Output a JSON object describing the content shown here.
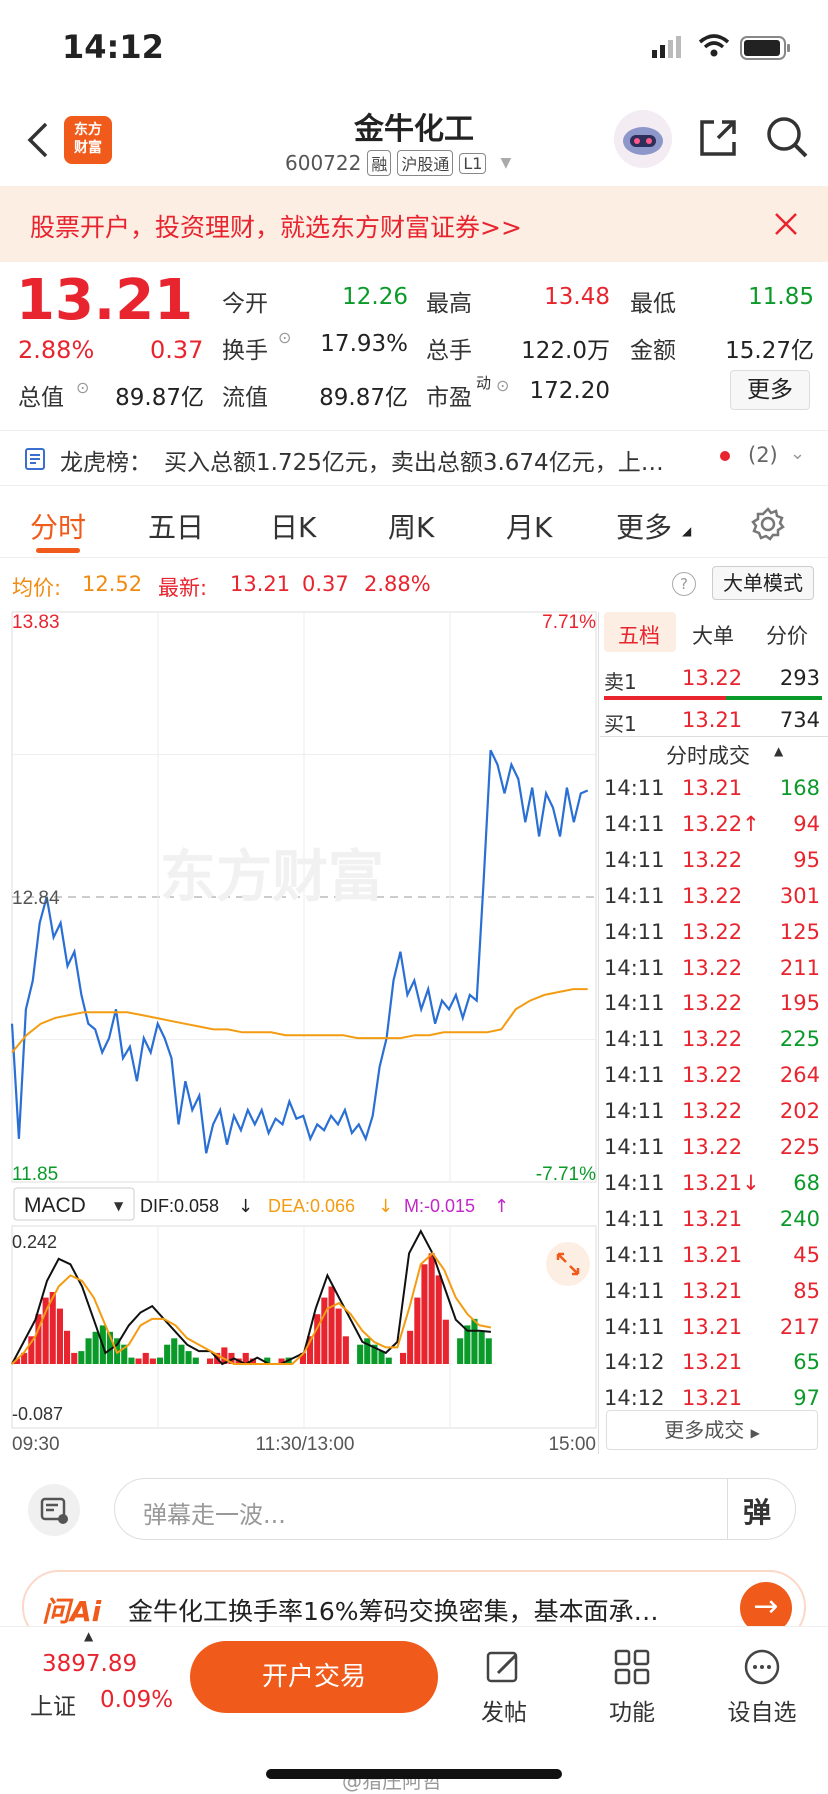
{
  "status_bar": {
    "time": "14:12"
  },
  "header": {
    "stock_name": "金牛化工",
    "stock_code": "600722",
    "tags": [
      "融",
      "沪股通",
      "L1"
    ],
    "logo_text": "东方财富"
  },
  "banner": {
    "text": "股票开户，投资理财，就选东方财富证券>>"
  },
  "quote": {
    "price": "13.21",
    "change_pct": "2.88%",
    "change": "0.37",
    "labels": {
      "open": "今开",
      "high": "最高",
      "low": "最低",
      "turnover": "换手",
      "volume": "总手",
      "amount": "金额",
      "market_cap": "总值",
      "float_cap": "流值",
      "pe": "市盈",
      "pe_sup": "动"
    },
    "values": {
      "open": "12.26",
      "high": "13.48",
      "low": "11.85",
      "turnover": "17.93%",
      "volume": "122.0万",
      "amount": "15.27亿",
      "market_cap": "89.87亿",
      "float_cap": "89.87亿",
      "pe": "172.20"
    },
    "more_button": "更多"
  },
  "dragon": {
    "label": "龙虎榜：",
    "text": "买入总额1.725亿元，卖出总额3.674亿元，上…",
    "count": "(2)"
  },
  "tabs": [
    "分时",
    "五日",
    "日K",
    "周K",
    "月K",
    "更多"
  ],
  "info_line": {
    "avg_label": "均价:",
    "avg_value": "12.52",
    "latest_label": "最新:",
    "latest_value": "13.21",
    "latest_change": "0.37",
    "latest_pct": "2.88%",
    "big_order_mode": "大单模式"
  },
  "chart_data": {
    "type": "line",
    "title": "",
    "x_labels": [
      "09:30",
      "11:30/13:00",
      "15:00"
    ],
    "ylim": [
      11.85,
      13.83
    ],
    "y_top_label": "13.83",
    "y_mid_label": "12.84",
    "y_bottom_label": "11.85",
    "pct_top_label": "7.71%",
    "pct_bottom_label": "-7.71%",
    "watermark": "东方财富",
    "series": [
      {
        "name": "price",
        "color": "#2a6fd4",
        "values": [
          12.4,
          12.0,
          12.45,
          12.55,
          12.75,
          12.84,
          12.7,
          12.75,
          12.6,
          12.65,
          12.5,
          12.4,
          12.38,
          12.3,
          12.35,
          12.45,
          12.28,
          12.32,
          12.2,
          12.35,
          12.3,
          12.4,
          12.35,
          12.28,
          12.05,
          12.2,
          12.1,
          12.15,
          11.95,
          12.05,
          12.1,
          11.98,
          12.08,
          12.03,
          12.1,
          12.05,
          12.1,
          12.02,
          12.07,
          12.05,
          12.13,
          12.07,
          12.08,
          12.0,
          12.05,
          12.03,
          12.08,
          12.05,
          12.1,
          12.02,
          12.05,
          12.0,
          12.08,
          12.25,
          12.35,
          12.55,
          12.65,
          12.5,
          12.55,
          12.45,
          12.52,
          12.4,
          12.48,
          12.45,
          12.5,
          12.42,
          12.5,
          12.48,
          12.9,
          13.35,
          13.3,
          13.2,
          13.3,
          13.25,
          13.1,
          13.22,
          13.05,
          13.2,
          13.15,
          13.05,
          13.22,
          13.1,
          13.2,
          13.21
        ]
      },
      {
        "name": "avg",
        "color": "#f39c12",
        "values": [
          12.3,
          12.36,
          12.4,
          12.42,
          12.43,
          12.44,
          12.44,
          12.44,
          12.44,
          12.43,
          12.42,
          12.41,
          12.4,
          12.39,
          12.38,
          12.38,
          12.37,
          12.37,
          12.37,
          12.36,
          12.36,
          12.36,
          12.36,
          12.36,
          12.35,
          12.35,
          12.35,
          12.35,
          12.36,
          12.36,
          12.37,
          12.37,
          12.37,
          12.37,
          12.38,
          12.45,
          12.48,
          12.5,
          12.51,
          12.52,
          12.52
        ]
      }
    ]
  },
  "macd": {
    "label": "MACD",
    "dif": "DIF:0.058",
    "dea": "DEA:0.066",
    "m": "M:-0.015",
    "y_top": "0.242",
    "y_bottom": "-0.087",
    "hist": [
      0.01,
      0.02,
      0.05,
      0.09,
      0.12,
      0.13,
      0.1,
      0.06,
      0.02,
      -0.02,
      -0.04,
      -0.05,
      -0.06,
      -0.05,
      -0.04,
      -0.03,
      -0.01,
      0.01,
      0.02,
      0.01,
      -0.01,
      -0.03,
      -0.04,
      -0.03,
      -0.02,
      -0.01,
      0.0,
      0.01,
      0.02,
      0.03,
      0.02,
      0.01,
      0.02,
      0.01,
      0.0,
      -0.01,
      0.0,
      0.01,
      -0.01,
      0.0,
      0.02,
      0.05,
      0.09,
      0.12,
      0.14,
      0.1,
      0.05,
      0.0,
      -0.03,
      -0.04,
      -0.03,
      -0.02,
      -0.01,
      0.0,
      0.02,
      0.06,
      0.12,
      0.18,
      0.2,
      0.16,
      0.08,
      0.0,
      -0.04,
      -0.06,
      -0.07,
      -0.05,
      -0.04
    ],
    "dif_line": [
      0.0,
      0.04,
      0.08,
      0.15,
      0.19,
      0.18,
      0.14,
      0.08,
      0.02,
      -0.03,
      -0.06,
      -0.08,
      -0.09,
      -0.07,
      -0.05,
      -0.03,
      -0.02,
      -0.02,
      0.0,
      0.01,
      0.0,
      -0.01,
      0.0,
      0.0,
      0.01,
      0.02,
      0.1,
      0.16,
      0.12,
      0.08,
      0.04,
      0.03,
      0.02,
      0.04,
      0.2,
      0.24,
      0.2,
      0.14,
      0.08,
      0.06,
      0.06,
      0.058
    ],
    "dea_line": [
      0.0,
      0.02,
      0.05,
      0.1,
      0.14,
      0.16,
      0.15,
      0.12,
      0.07,
      0.02,
      -0.03,
      -0.06,
      -0.07,
      -0.07,
      -0.06,
      -0.04,
      -0.03,
      -0.02,
      -0.01,
      0.0,
      0.0,
      0.0,
      0.0,
      0.0,
      0.0,
      0.02,
      0.06,
      0.1,
      0.11,
      0.09,
      0.06,
      0.04,
      0.03,
      0.03,
      0.1,
      0.18,
      0.2,
      0.17,
      0.12,
      0.09,
      0.07,
      0.066
    ]
  },
  "right_panel": {
    "tabs": [
      "五档",
      "大单",
      "分价"
    ],
    "sell1": {
      "label": "卖1",
      "price": "13.22",
      "vol": "293"
    },
    "buy1": {
      "label": "买1",
      "price": "13.21",
      "vol": "734"
    },
    "trades_title": "分时成交",
    "trades": [
      {
        "t": "14:11",
        "p": "13.21",
        "v": "168",
        "c": "green"
      },
      {
        "t": "14:11",
        "p": "13.22↑",
        "v": "94",
        "c": "red"
      },
      {
        "t": "14:11",
        "p": "13.22",
        "v": "95",
        "c": "red"
      },
      {
        "t": "14:11",
        "p": "13.22",
        "v": "301",
        "c": "red"
      },
      {
        "t": "14:11",
        "p": "13.22",
        "v": "125",
        "c": "red"
      },
      {
        "t": "14:11",
        "p": "13.22",
        "v": "211",
        "c": "red"
      },
      {
        "t": "14:11",
        "p": "13.22",
        "v": "195",
        "c": "red"
      },
      {
        "t": "14:11",
        "p": "13.22",
        "v": "225",
        "c": "green"
      },
      {
        "t": "14:11",
        "p": "13.22",
        "v": "264",
        "c": "red"
      },
      {
        "t": "14:11",
        "p": "13.22",
        "v": "202",
        "c": "red"
      },
      {
        "t": "14:11",
        "p": "13.22",
        "v": "225",
        "c": "red"
      },
      {
        "t": "14:11",
        "p": "13.21↓",
        "v": "68",
        "c": "green"
      },
      {
        "t": "14:11",
        "p": "13.21",
        "v": "240",
        "c": "green"
      },
      {
        "t": "14:11",
        "p": "13.21",
        "v": "45",
        "c": "red"
      },
      {
        "t": "14:11",
        "p": "13.21",
        "v": "85",
        "c": "red"
      },
      {
        "t": "14:11",
        "p": "13.21",
        "v": "217",
        "c": "red"
      },
      {
        "t": "14:12",
        "p": "13.21",
        "v": "65",
        "c": "green"
      },
      {
        "t": "14:12",
        "p": "13.21",
        "v": "97",
        "c": "green"
      }
    ],
    "more_trades": "更多成交"
  },
  "comment": {
    "placeholder": "弹幕走一波...",
    "danmu_button": "弹"
  },
  "ai_bar": {
    "logo": "问Ai",
    "text": "金牛化工换手率16%筹码交换密集，基本面承…"
  },
  "bottom_bar": {
    "index_value": "3897.89",
    "index_name": "上证",
    "index_pct": "0.09%",
    "trade_button": "开户交易",
    "nav": [
      "发帖",
      "功能",
      "设自选"
    ]
  },
  "watermark": "@猎庄阿哲",
  "colors": {
    "up": "#e8242e",
    "down": "#0a9a2a",
    "brand": "#f05a1a",
    "avg": "#f39c12",
    "price_line": "#2a6fd4"
  }
}
